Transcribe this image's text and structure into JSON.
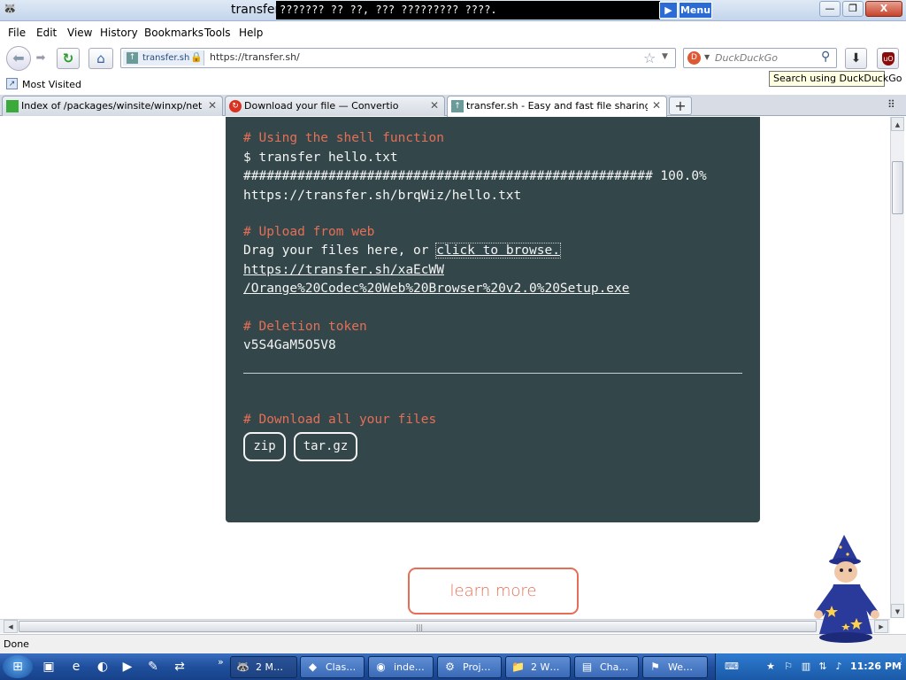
{
  "window": {
    "title": "transfer",
    "speech_bar_text": "??????? ?? ??, ??? ????????? ????.",
    "speech_menu_label": "Menu",
    "speech_play_label": "▶",
    "min_label": "—",
    "max_label": "❐",
    "close_label": "X"
  },
  "menubar": {
    "file": "File",
    "edit": "Edit",
    "view": "View",
    "history": "History",
    "bookmarks": "Bookmarks",
    "tools": "Tools",
    "help": "Help"
  },
  "navbar": {
    "site_badge": "transfer.sh",
    "url": "https://transfer.sh/",
    "search_placeholder": "DuckDuckGo",
    "search_tooltip": "Search using DuckDuckGo"
  },
  "bookmarks": {
    "most_visited": "Most Visited"
  },
  "tabs": [
    {
      "label": "Index of /packages/winsite/winxp/netutil",
      "icon": "green-icon",
      "active": false
    },
    {
      "label": "Download your file — Convertio",
      "icon": "convertio-icon",
      "active": false
    },
    {
      "label": "transfer.sh - Easy and fast file sharing fr…",
      "icon": "transfer-icon",
      "active": true
    }
  ],
  "page": {
    "shell_comment": "# Using the shell function",
    "shell_cmd": "$ transfer hello.txt",
    "progress_line": "##################################################### 100.0%",
    "shell_result_url": "https://transfer.sh/brqWiz/hello.txt",
    "upload_comment": "# Upload from web",
    "drag_text": "Drag your files here, or ",
    "browse_link": "click to browse.",
    "uploaded_url_line1": "https://transfer.sh/xaEcWW",
    "uploaded_url_line2": "/Orange%20Codec%20Web%20Browser%20v2.0%20Setup.exe",
    "deletion_comment": "# Deletion token",
    "deletion_token": "v5S4GaM5O5V8",
    "download_comment": "# Download all your files",
    "zip_button": "zip",
    "targz_button": "tar.gz",
    "learn_more": "learn more"
  },
  "status": {
    "text": "Done"
  },
  "taskbar": {
    "buttons": [
      {
        "label": "2 M…"
      },
      {
        "label": "Clas…"
      },
      {
        "label": "inde…"
      },
      {
        "label": "Proj…"
      },
      {
        "label": "2 W…"
      },
      {
        "label": "Cha…"
      },
      {
        "label": "We…"
      }
    ],
    "clock": "11:26 PM"
  },
  "colors": {
    "terminal_bg": "#33474b",
    "comment_accent": "#e56f56",
    "taskbar_blue": "#1f4f9c"
  }
}
